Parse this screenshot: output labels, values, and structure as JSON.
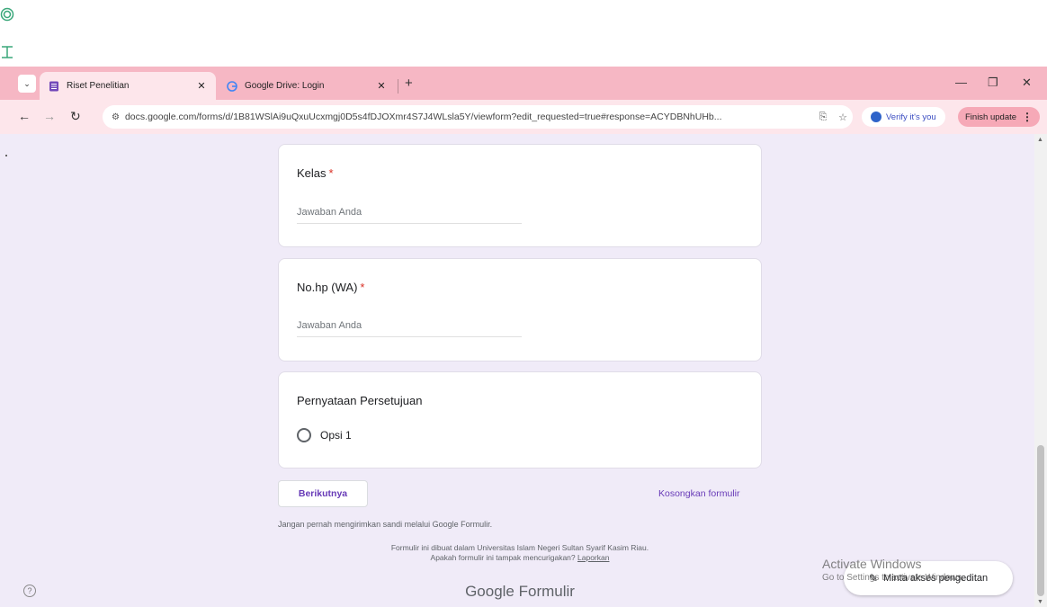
{
  "browser": {
    "tabs": [
      {
        "title": "Riset Penelitian",
        "favicon": "forms-icon",
        "active": true
      },
      {
        "title": "Google Drive: Login",
        "favicon": "google-icon",
        "active": false
      }
    ],
    "new_tab": "+",
    "url": "docs.google.com/forms/d/1B81WSlAi9uQxuUcxmgj0D5s4fDJOXmr4S7J4WLsla5Y/viewform?edit_requested=true#response=ACYDBNhUHb...",
    "verify_label": "Verify it's you",
    "finish_label": "Finish update"
  },
  "form": {
    "questions": [
      {
        "title": "Kelas",
        "required": "*",
        "placeholder": "Jawaban Anda"
      },
      {
        "title": "No.hp (WA)",
        "required": "*",
        "placeholder": "Jawaban Anda"
      }
    ],
    "consent": {
      "title": "Pernyataan Persetujuan",
      "option": "Opsi 1"
    },
    "next_label": "Berikutnya",
    "clear_label": "Kosongkan formulir",
    "warning": "Jangan pernah mengirimkan sandi melalui Google Formulir.",
    "footer_line1": "Formulir ini dibuat dalam Universitas Islam Negeri Sultan Syarif Kasim Riau.",
    "footer_line2": "Apakah formulir ini tampak mencurigakan?",
    "report_link": "Laporkan",
    "brand": "Google Formulir",
    "edit_access": "Minta akses pengeditan"
  },
  "overlay": {
    "activate_title": "Activate Windows",
    "activate_sub": "Go to Settings to activate Windows."
  },
  "colors": {
    "accent": "#673ab7",
    "required": "#d93025",
    "page_bg": "#f0ebf8",
    "tabbar": "#f6b7c4"
  }
}
